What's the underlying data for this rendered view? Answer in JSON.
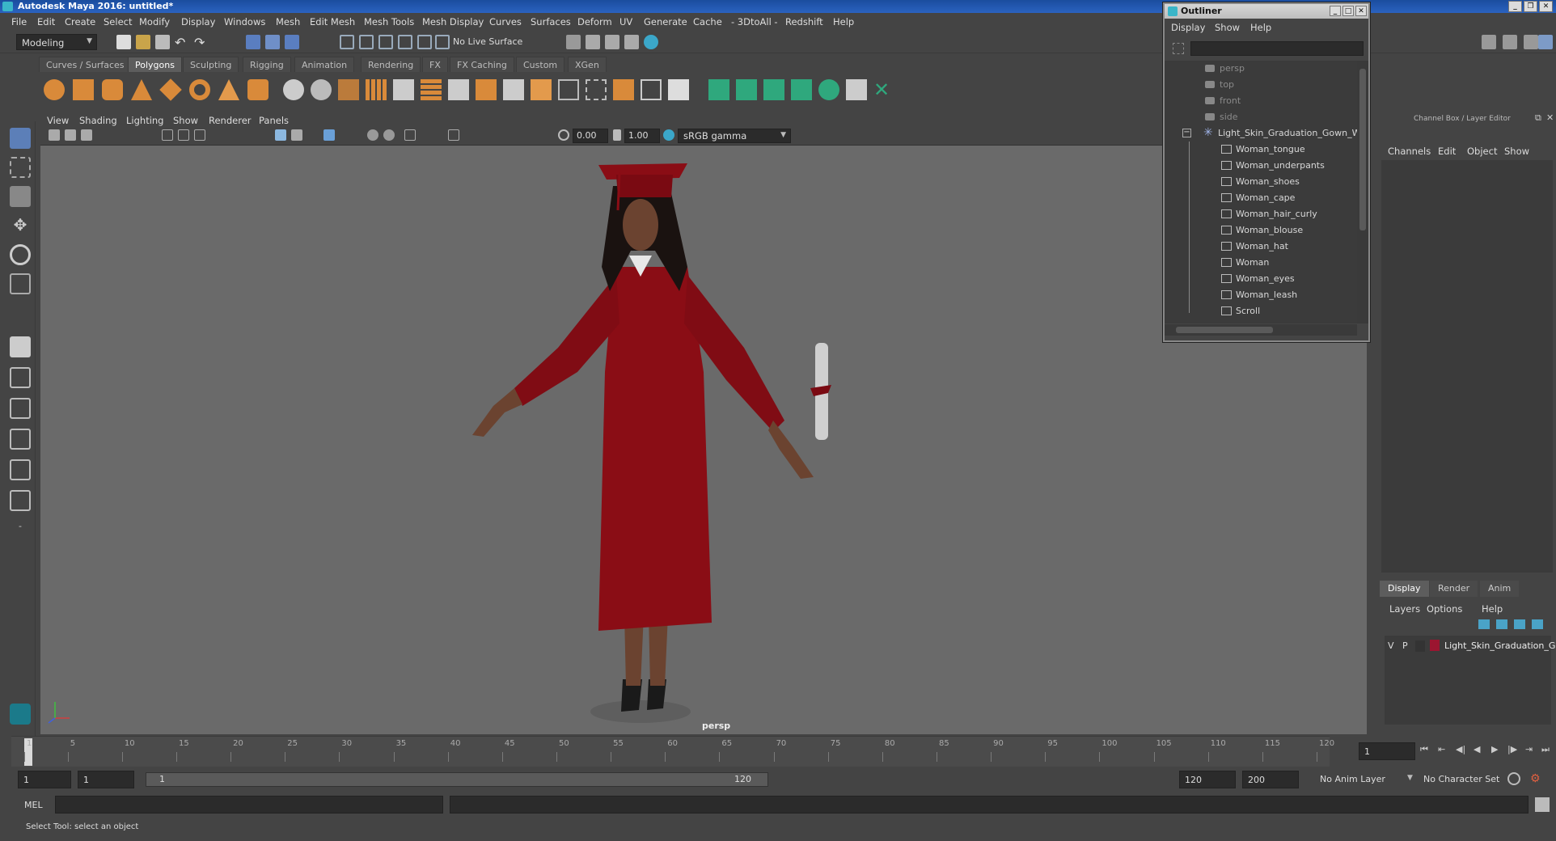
{
  "window": {
    "title": "Autodesk Maya 2016: untitled*"
  },
  "menubar": [
    "File",
    "Edit",
    "Create",
    "Select",
    "Modify",
    "Display",
    "Windows",
    "Mesh",
    "Edit Mesh",
    "Mesh Tools",
    "Mesh Display",
    "Curves",
    "Surfaces",
    "Deform",
    "UV",
    "Generate",
    "Cache",
    "- 3DtoAll -",
    "Redshift",
    "Help"
  ],
  "statusline": {
    "mode": "Modeling",
    "live_surface": "No Live Surface"
  },
  "shelf_tabs": [
    "Curves / Surfaces",
    "Polygons",
    "Sculpting",
    "Rigging",
    "Animation",
    "Rendering",
    "FX",
    "FX Caching",
    "Custom",
    "XGen"
  ],
  "shelf_active": "Polygons",
  "panel_menu": [
    "View",
    "Shading",
    "Lighting",
    "Show",
    "Renderer",
    "Panels"
  ],
  "view_toolbar": {
    "exposure": "0.00",
    "gamma": "1.00",
    "color_space": "sRGB gamma"
  },
  "viewport": {
    "camera_label": "persp"
  },
  "outliner": {
    "title": "Outliner",
    "menus": [
      "Display",
      "Show",
      "Help"
    ],
    "items": [
      {
        "label": "persp",
        "kind": "camera",
        "dim": true
      },
      {
        "label": "top",
        "kind": "camera",
        "dim": true
      },
      {
        "label": "front",
        "kind": "camera",
        "dim": true
      },
      {
        "label": "side",
        "kind": "camera",
        "dim": true
      },
      {
        "label": "Light_Skin_Graduation_Gown_W",
        "kind": "group",
        "dim": false
      },
      {
        "label": "Woman_tongue",
        "kind": "mesh",
        "dim": false
      },
      {
        "label": "Woman_underpants",
        "kind": "mesh",
        "dim": false
      },
      {
        "label": "Woman_shoes",
        "kind": "mesh",
        "dim": false
      },
      {
        "label": "Woman_cape",
        "kind": "mesh",
        "dim": false
      },
      {
        "label": "Woman_hair_curly",
        "kind": "mesh",
        "dim": false
      },
      {
        "label": "Woman_blouse",
        "kind": "mesh",
        "dim": false
      },
      {
        "label": "Woman_hat",
        "kind": "mesh",
        "dim": false
      },
      {
        "label": "Woman",
        "kind": "mesh",
        "dim": false
      },
      {
        "label": "Woman_eyes",
        "kind": "mesh",
        "dim": false
      },
      {
        "label": "Woman_leash",
        "kind": "mesh",
        "dim": false
      },
      {
        "label": "Scroll",
        "kind": "mesh",
        "dim": false
      }
    ]
  },
  "channel_box": {
    "title": "Channel Box / Layer Editor",
    "menus": [
      "Channels",
      "Edit",
      "Object",
      "Show"
    ]
  },
  "layer_editor": {
    "tabs": [
      "Display",
      "Render",
      "Anim"
    ],
    "active_tab": "Display",
    "menus": [
      "Layers",
      "Options",
      "Help"
    ],
    "layers": [
      {
        "v": "V",
        "p": "P",
        "name": "Light_Skin_Graduation_G",
        "color": "#9b1530"
      }
    ]
  },
  "time_slider": {
    "ticks": [
      1,
      5,
      10,
      15,
      20,
      25,
      30,
      35,
      40,
      45,
      50,
      55,
      60,
      65,
      70,
      75,
      80,
      85,
      90,
      95,
      100,
      105,
      110,
      115,
      120
    ],
    "current_frame": "1"
  },
  "range": {
    "start": "1",
    "playback_start": "1",
    "slider_start": "1",
    "slider_end": "120",
    "playback_end": "120",
    "end": "200",
    "anim_layer": "No Anim Layer",
    "character_set": "No Character Set"
  },
  "command_line": {
    "language": "MEL"
  },
  "help_line": {
    "text": "Select Tool: select an object"
  },
  "colors": {
    "gown": "#8a0d15",
    "viewport_bg": "#6a6a6a",
    "ui_bg": "#444444"
  }
}
